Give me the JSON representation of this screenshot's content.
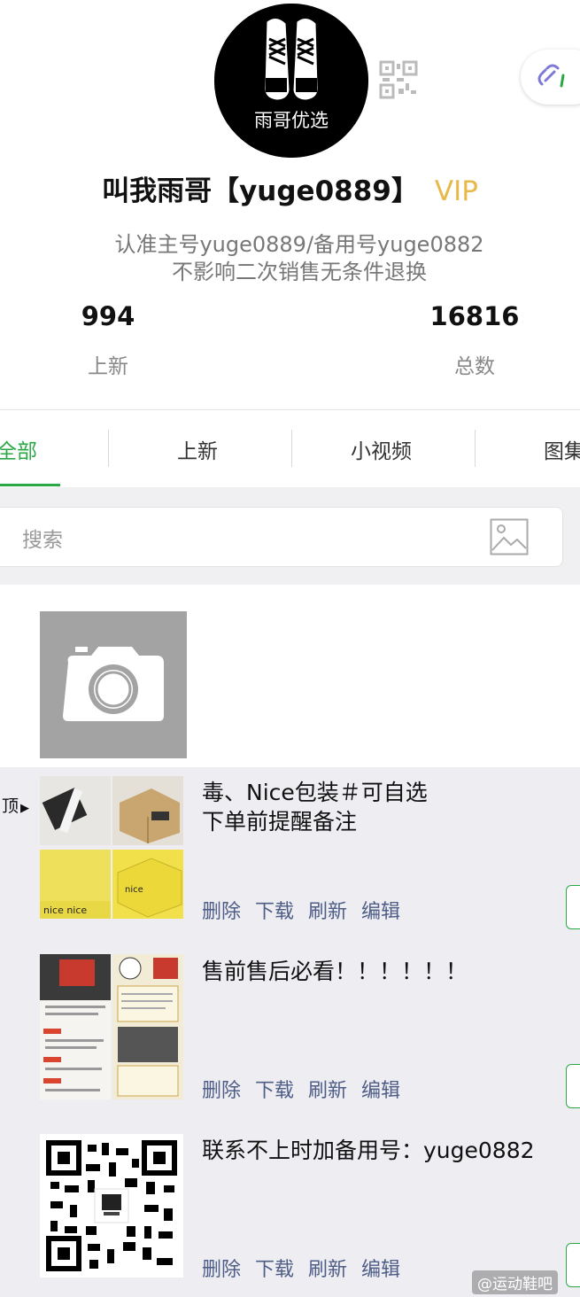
{
  "profile": {
    "avatar_text": "雨哥优选",
    "name": "叫我雨哥【yuge0889】",
    "vip_label": "VIP",
    "bio_line1": "认准主号yuge0889/备用号yuge0882",
    "bio_line2": "不影响二次销售无条件退换"
  },
  "stats": [
    {
      "value": "994",
      "label": "上新"
    },
    {
      "value": "16816",
      "label": "总数"
    }
  ],
  "tabs": [
    {
      "label": "全部",
      "active": true
    },
    {
      "label": "上新",
      "active": false
    },
    {
      "label": "小视频",
      "active": false
    },
    {
      "label": "图集",
      "active": false
    }
  ],
  "search": {
    "placeholder": "搜索"
  },
  "pin_label": "顶",
  "items": [
    {
      "title_line1": "毒、Nice包装＃可自选",
      "title_line2": "下单前提醒备注",
      "actions": [
        "删除",
        "下载",
        "刷新",
        "编辑"
      ]
    },
    {
      "title_line1": "售前售后必看！！！！！！",
      "title_line2": "",
      "actions": [
        "删除",
        "下载",
        "刷新",
        "编辑"
      ]
    },
    {
      "title_line1": "联系不上时加备用号：yuge0882",
      "title_line2": "",
      "actions": [
        "删除",
        "下载",
        "刷新",
        "编辑"
      ]
    }
  ],
  "watermark": "@运动鞋吧",
  "colors": {
    "accent_green": "#2aa846",
    "vip_gold": "#e8b94a",
    "action_blue": "#4e5d86"
  }
}
